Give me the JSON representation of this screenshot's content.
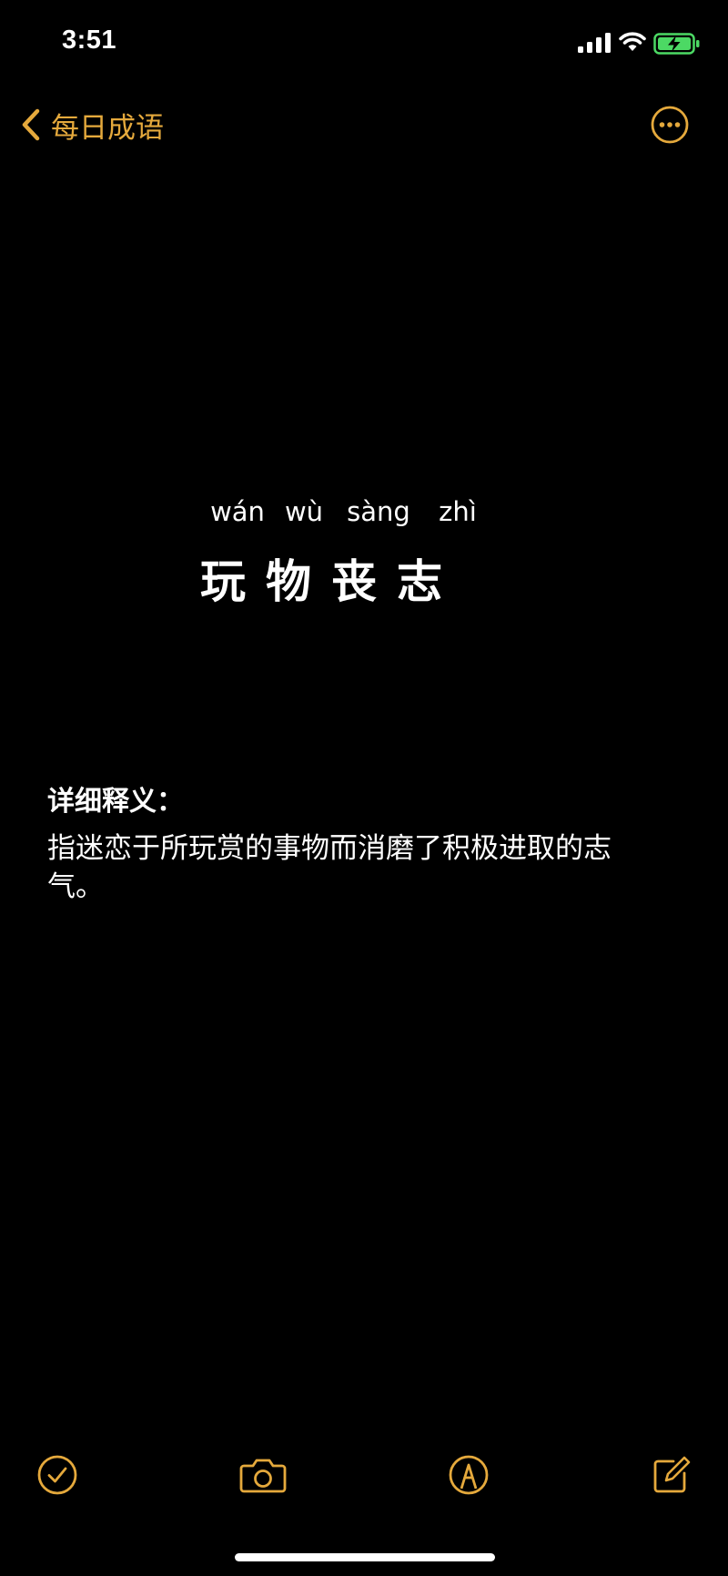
{
  "status_bar": {
    "time": "3:51",
    "signal_icon": "cellular-signal-icon",
    "wifi_icon": "wifi-icon",
    "battery_icon": "battery-charging-icon",
    "battery_color": "#4cd964"
  },
  "nav": {
    "back_label": "每日成语",
    "back_icon": "chevron-left-icon",
    "more_icon": "ellipsis-circle-icon",
    "accent_color": "#e5a93c"
  },
  "idiom": {
    "pinyin": [
      "wán",
      "wù",
      "sàng",
      "zhì"
    ],
    "characters": [
      "玩",
      "物",
      "丧",
      "志"
    ]
  },
  "definition": {
    "heading": "详细释义：",
    "text": "指迷恋于所玩赏的事物而消磨了积极进取的志气。"
  },
  "toolbar": {
    "icons": [
      "checklist-icon",
      "camera-icon",
      "markup-pen-icon",
      "compose-icon"
    ]
  }
}
